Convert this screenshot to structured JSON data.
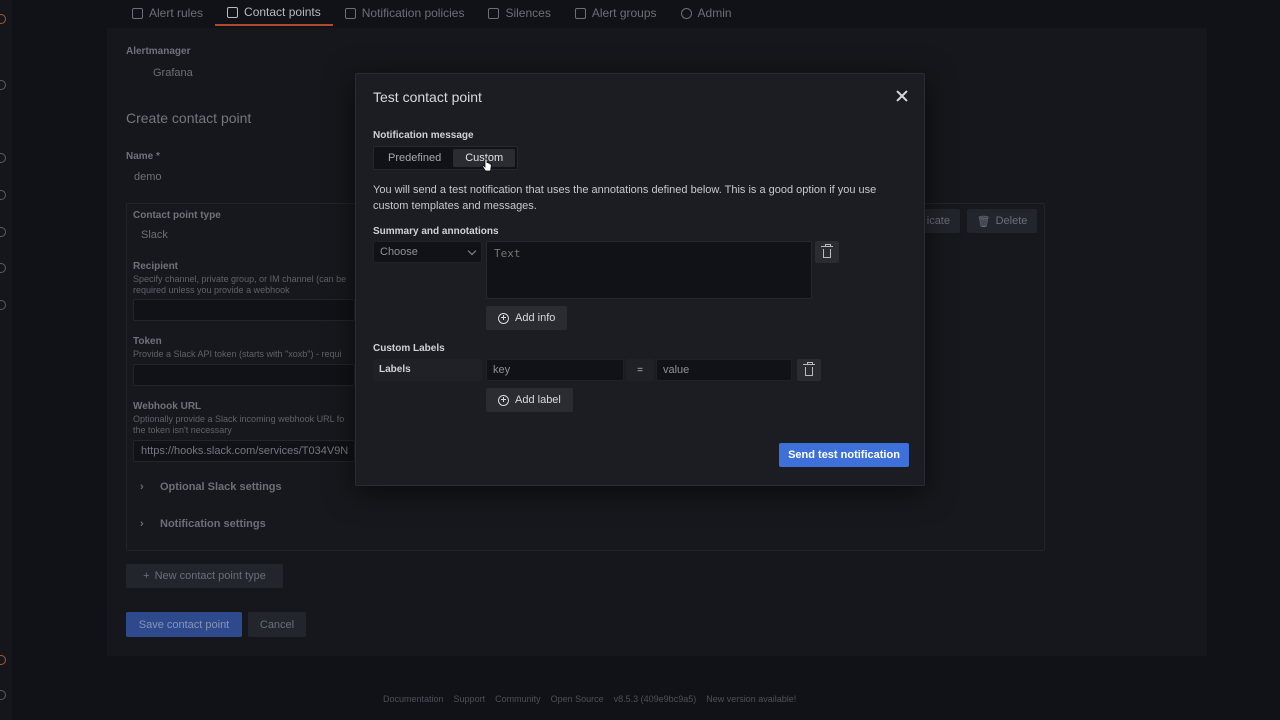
{
  "tabs": [
    {
      "label": "Alert rules",
      "icon": "list-icon"
    },
    {
      "label": "Contact points",
      "icon": "contact-icon",
      "active": true
    },
    {
      "label": "Notification policies",
      "icon": "policy-icon"
    },
    {
      "label": "Silences",
      "icon": "silence-icon"
    },
    {
      "label": "Alert groups",
      "icon": "group-icon"
    },
    {
      "label": "Admin",
      "icon": "gear-icon"
    }
  ],
  "background": {
    "alertmanager_label": "Alertmanager",
    "alertmanager_value": "Grafana",
    "page_title": "Create contact point",
    "name_label": "Name *",
    "name_value": "demo",
    "contact_type_label": "Contact point type",
    "contact_type_value": "Slack",
    "recipient_label": "Recipient",
    "recipient_help": "Specify channel, private group, or IM channel (can be",
    "recipient_help2": "required unless you provide a webhook",
    "token_label": "Token",
    "token_help": "Provide a Slack API token (starts with \"xoxb\") - requi",
    "webhook_label": "Webhook URL",
    "webhook_help": "Optionally provide a Slack incoming webhook URL fo",
    "webhook_help2": "the token isn't necessary",
    "webhook_value": "https://hooks.slack.com/services/T034V9N",
    "optional_slack": "Optional Slack settings",
    "notification_settings": "Notification settings",
    "duplicate_label": "icate",
    "delete_label": "Delete",
    "new_type_label": "New contact point type",
    "save_label": "Save contact point",
    "cancel_label": "Cancel"
  },
  "footer": {
    "documentation": "Documentation",
    "support": "Support",
    "community": "Community",
    "open_source": "Open Source",
    "version": "v8.5.3 (409e9bc9a5)",
    "new_version": "New version available!"
  },
  "modal": {
    "title": "Test contact point",
    "notification_message_label": "Notification message",
    "segment_options": [
      "Predefined",
      "Custom"
    ],
    "selected_option": "Custom",
    "description": "You will send a test notification that uses the annotations defined below. This is a good option if you use custom templates and messages.",
    "summary_label": "Summary and annotations",
    "choose_placeholder": "Choose",
    "text_placeholder": "Text",
    "add_info_label": "Add info",
    "custom_labels_label": "Custom Labels",
    "labels_label": "Labels",
    "key_placeholder": "key",
    "equals": "=",
    "value_placeholder": "value",
    "add_label_label": "Add label",
    "send_label": "Send test notification"
  },
  "colors": {
    "primary": "#3d71d9",
    "active_tab_underline": "#b04a2c",
    "modal_bg": "#1c1d22"
  }
}
